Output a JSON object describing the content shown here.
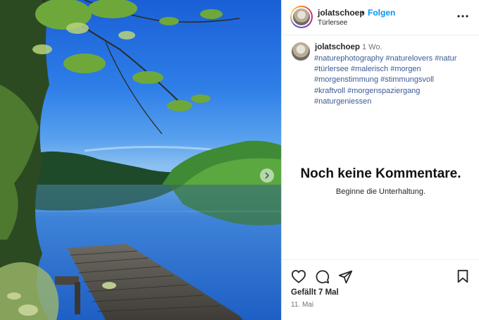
{
  "post": {
    "header": {
      "username": "jolatschoep",
      "separator": "•",
      "follow_label": "Folgen",
      "location": "Türlersee"
    },
    "caption": {
      "username": "jolatschoep",
      "time_ago": "1 Wo.",
      "hashtag_lines": [
        "#naturephotography #naturelovers #natur",
        "#türlersee #malerisch #morgen",
        "#morgenstimmung #stimmungsvoll",
        "#kraftvoll #morgenspaziergang",
        "#naturgeniessen"
      ]
    },
    "comments": {
      "empty_title": "Noch keine Kommentare.",
      "empty_subtitle": "Beginne die Unterhaltung."
    },
    "footer": {
      "likes": "Gefällt 7 Mal",
      "date": "11. Mai"
    },
    "icons": {
      "more": "more-options-icon",
      "like": "heart-icon",
      "comment": "comment-icon",
      "share": "send-icon",
      "save": "bookmark-icon",
      "next": "chevron-right-icon"
    },
    "colors": {
      "follow": "#0095f6",
      "hashtag": "#3b5a96",
      "secondary_text": "#737373"
    }
  }
}
